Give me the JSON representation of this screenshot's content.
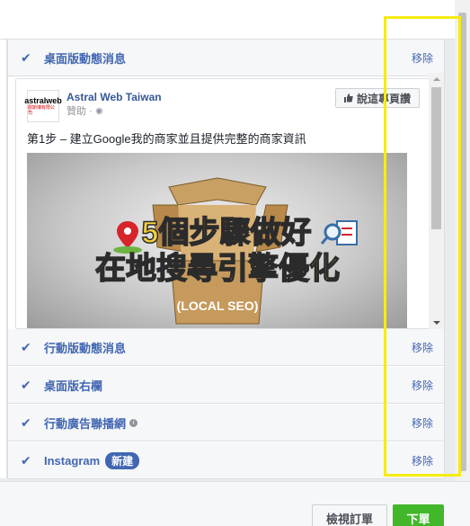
{
  "placements": [
    {
      "label": "桌面版動態消息",
      "remove": "移除",
      "checked": true
    },
    {
      "label": "行動版動態消息",
      "remove": "移除",
      "checked": true
    },
    {
      "label": "桌面版右欄",
      "remove": "移除",
      "checked": true
    },
    {
      "label": "行動廣告聯播網",
      "remove": "移除",
      "checked": true,
      "info": "i"
    },
    {
      "label": "Instagram",
      "remove": "移除",
      "checked": true,
      "badge": "新建"
    }
  ],
  "check_glyph": "✔",
  "preview": {
    "page_name": "Astral Web Taiwan",
    "sponsored": "贊助 · ",
    "like_button": "說這專頁讚",
    "post_text": "第1步 – 建立Google我的商家並且提供完整的商家資訊",
    "avatar_text": "astralweb",
    "avatar_subtext": "歐斯瑞有限公司",
    "image_line1": "5個步驟做好",
    "image_line2": "在地搜尋引擎優化",
    "image_line3": "(LOCAL SEO)"
  },
  "footer": {
    "review_button": "檢視訂單",
    "order_button": "下單"
  },
  "colors": {
    "link_blue": "#4267b2",
    "highlight_yellow": "#f5ec12",
    "order_green": "#42b72a"
  }
}
